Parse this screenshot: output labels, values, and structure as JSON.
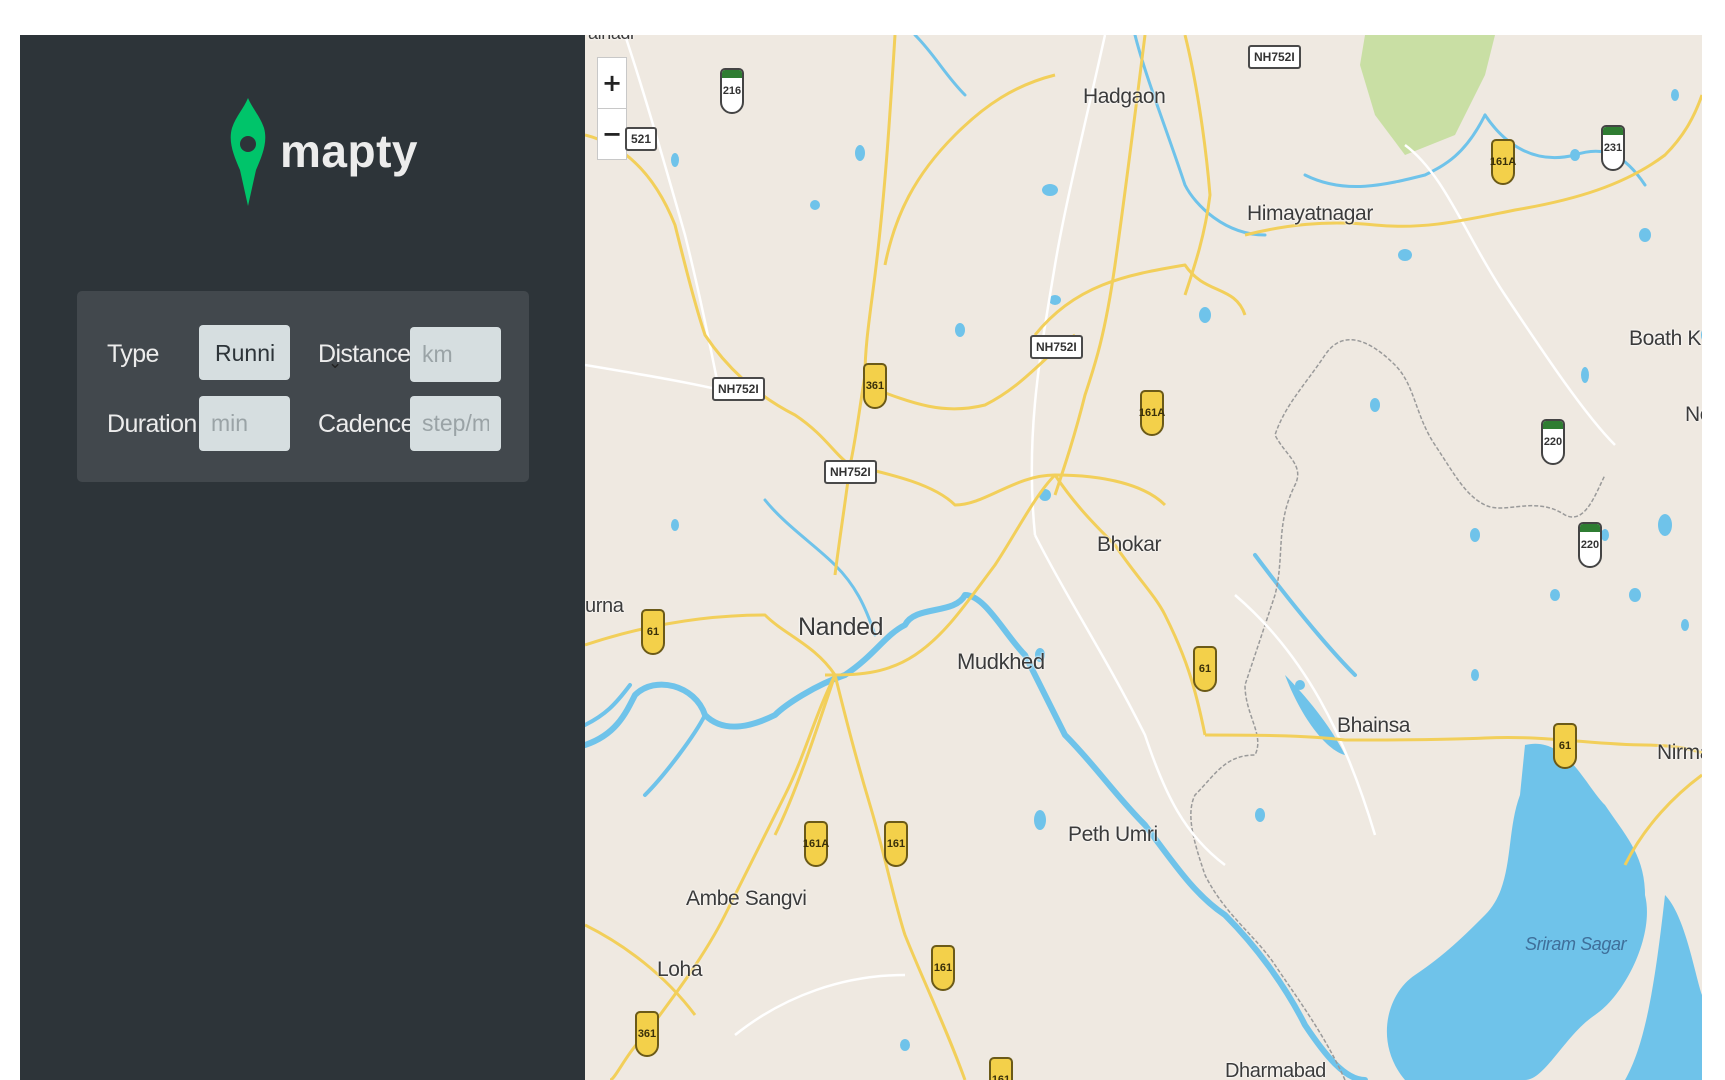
{
  "sidebar": {
    "logo": {
      "icon": "location-pin-icon",
      "text": "mapty",
      "color": "#00c46a"
    },
    "form": {
      "type_label": "Type",
      "type_value": "Runni",
      "distance_label": "Distance",
      "distance_placeholder": "km",
      "duration_label": "Duration",
      "duration_placeholder": "min",
      "cadence_label": "Cadence",
      "cadence_placeholder": "step/min"
    }
  },
  "map": {
    "zoom_in": "+",
    "zoom_out": "−",
    "places": {
      "hadgaon": "Hadgaon",
      "himayatnagar": "Himayatnagar",
      "boath": "Boath K",
      "ne": "Ne",
      "bhokar": "Bhokar",
      "nanded": "Nanded",
      "mudkhed": "Mudkhed",
      "purna": "urna",
      "bhainsa": "Bhainsa",
      "nirmal": "Nirma",
      "peth_umri": "Peth Umri",
      "ambe_sangvi": "Ambe Sangvi",
      "loha": "Loha",
      "sriram_sagar": "Sriram Sagar",
      "dharmabad": "Dharmabad",
      "top_partial": "alnadi"
    },
    "markers": {
      "nh752i": "NH752I",
      "nh752i_partial": "521",
      "s216": "216",
      "s161a": "161A",
      "s231": "231",
      "s361": "361",
      "s220": "220",
      "s61": "61",
      "s161": "161"
    },
    "colors": {
      "land": "#efe9e1",
      "water": "#6fc3ea",
      "road": "#f2cf5a",
      "park": "#c9dfa4"
    }
  }
}
